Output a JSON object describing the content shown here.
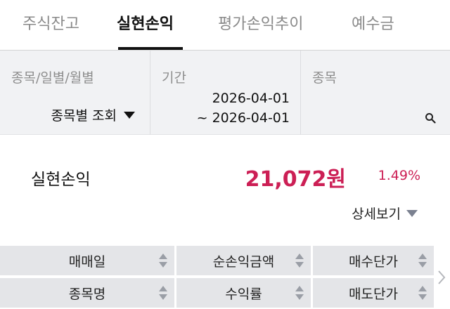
{
  "tabs": [
    {
      "label": "주식잔고",
      "active": false
    },
    {
      "label": "실현손익",
      "active": true
    },
    {
      "label": "평가손익추이",
      "active": false
    },
    {
      "label": "예수금",
      "active": false
    }
  ],
  "filters": {
    "type": {
      "label": "종목/일별/월별",
      "value": "종목별 조회"
    },
    "period": {
      "label": "기간",
      "start": "2026-04-01",
      "end": "~ 2026-04-01"
    },
    "stock": {
      "label": "종목",
      "value": ""
    }
  },
  "profit": {
    "label": "실현손익",
    "amount": "21,072원",
    "rate": "1.49%"
  },
  "detail_toggle": "상세보기",
  "table_headers": {
    "row1": [
      "매매일",
      "순손익금액",
      "매수단가"
    ],
    "row2": [
      "종목명",
      "수익률",
      "매도단가"
    ]
  },
  "colors": {
    "accent": "#cc1f55",
    "tab_active": "#111111",
    "filter_bg": "#f1f2f4",
    "header_bg": "#e4e5e8"
  },
  "icons": [
    "search-icon",
    "caret-down-icon",
    "sort-icon",
    "chevron-right-icon"
  ]
}
